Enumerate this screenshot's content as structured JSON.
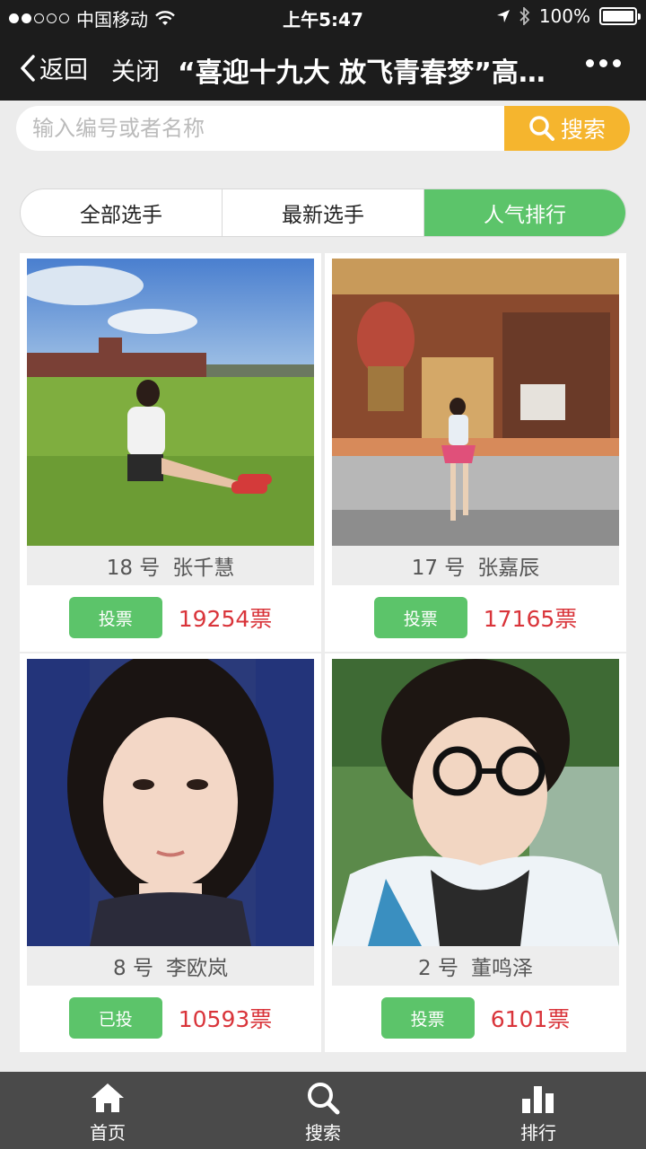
{
  "status_bar": {
    "carrier": "中国移动",
    "time": "上午5:47",
    "battery": "100%"
  },
  "nav": {
    "back_label": "返回",
    "close_label": "关闭",
    "title": "“喜迎十九大 放飞青春梦”高…"
  },
  "search": {
    "placeholder": "输入编号或者名称",
    "button_label": "搜索"
  },
  "tabs": [
    {
      "label": "全部选手",
      "active": false
    },
    {
      "label": "最新选手",
      "active": false
    },
    {
      "label": "人气排行",
      "active": true
    }
  ],
  "contestants": [
    {
      "number": "18 号",
      "name": "张千慧",
      "vote_label": "投票",
      "votes": "19254票"
    },
    {
      "number": "17 号",
      "name": "张嘉辰",
      "vote_label": "投票",
      "votes": "17165票"
    },
    {
      "number": "8 号",
      "name": "李欧岚",
      "vote_label": "已投",
      "votes": "10593票"
    },
    {
      "number": "2 号",
      "name": "董鸣泽",
      "vote_label": "投票",
      "votes": "6101票"
    }
  ],
  "tabbar": [
    {
      "label": "首页",
      "icon": "home-icon"
    },
    {
      "label": "搜索",
      "icon": "search-icon"
    },
    {
      "label": "排行",
      "icon": "bar-chart-icon"
    }
  ],
  "colors": {
    "accent_green": "#5cc46a",
    "search_orange": "#f5b52e",
    "votes_red": "#d9343a",
    "dark_bar": "#1c1c1c"
  }
}
